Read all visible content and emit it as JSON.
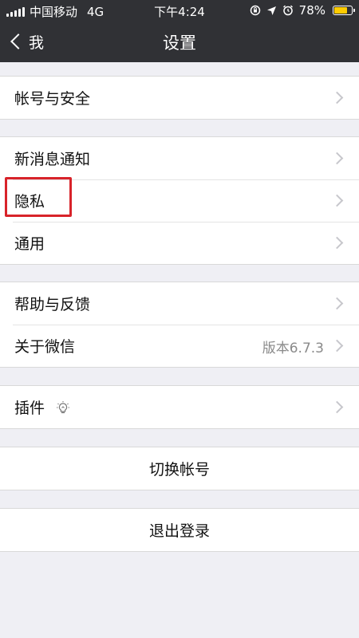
{
  "status_bar": {
    "carrier": "中国移动",
    "network": "4G",
    "time": "下午4:24",
    "battery_percent": "78%",
    "battery_level": 0.78,
    "battery_color": "#ffcc00"
  },
  "nav": {
    "back_label": "我",
    "title": "设置"
  },
  "groups": {
    "g1": {
      "items": [
        {
          "label": "帐号与安全"
        }
      ]
    },
    "g2": {
      "items": [
        {
          "label": "新消息通知"
        },
        {
          "label": "隐私"
        },
        {
          "label": "通用"
        }
      ]
    },
    "g3": {
      "items": [
        {
          "label": "帮助与反馈"
        },
        {
          "label": "关于微信",
          "value": "版本6.7.3"
        }
      ]
    },
    "g4": {
      "items": [
        {
          "label": "插件"
        }
      ]
    },
    "g5": {
      "items": [
        {
          "label": "切换帐号"
        }
      ]
    },
    "g6": {
      "items": [
        {
          "label": "退出登录"
        }
      ]
    }
  },
  "highlight_color": "#d8232a"
}
